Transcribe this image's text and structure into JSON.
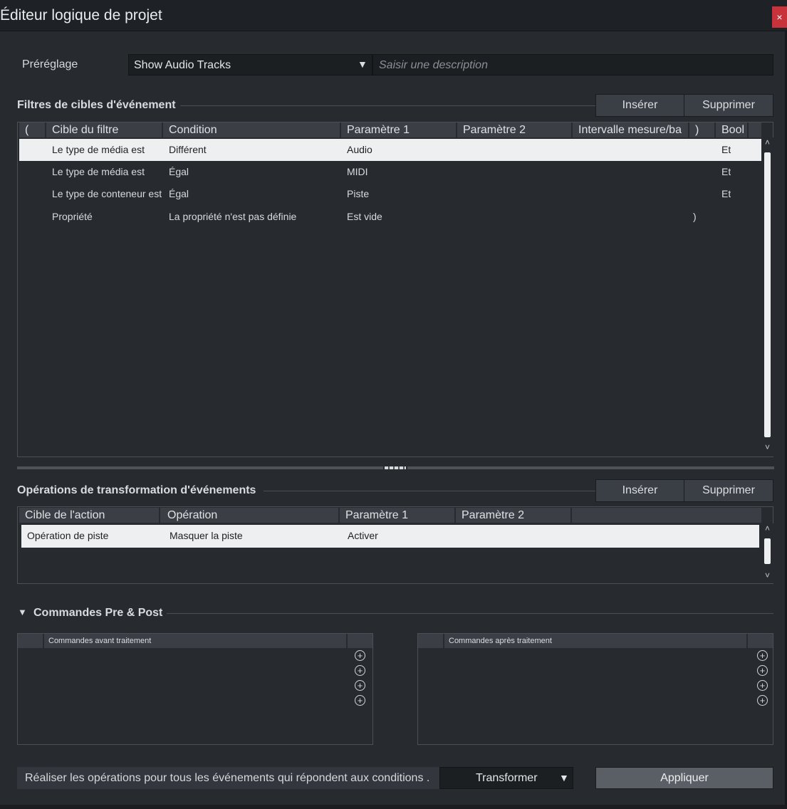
{
  "window": {
    "title": "Éditeur logique de projet",
    "close_icon": "×"
  },
  "preset": {
    "label": "Préréglage",
    "value": "Show Audio Tracks",
    "dropdown_icon": "▼",
    "description_placeholder": "Saisir une description"
  },
  "filters": {
    "title": "Filtres de cibles d'événement",
    "insert_label": "Insérer",
    "delete_label": "Supprimer",
    "headers": [
      "(",
      "Cible du filtre",
      "Condition",
      "Paramètre 1",
      "Paramètre 2",
      "Intervalle mesure/ba",
      ")",
      "Bool"
    ],
    "rows": [
      {
        "open": "",
        "target": "Le type de média est",
        "condition": "Différent",
        "param1": "Audio",
        "param2": "",
        "range": "",
        "close": "",
        "bool": "Et"
      },
      {
        "open": "",
        "target": "Le type de média est",
        "condition": "Égal",
        "param1": "MIDI",
        "param2": "",
        "range": "",
        "close": "",
        "bool": "Et"
      },
      {
        "open": "",
        "target": "Le type de conteneur est",
        "condition": "Égal",
        "param1": "Piste",
        "param2": "",
        "range": "",
        "close": "",
        "bool": "Et"
      },
      {
        "open": "",
        "target": "Propriété",
        "condition": "La propriété n'est pas définie",
        "param1": "Est vide",
        "param2": "",
        "range": "",
        "close": ")",
        "bool": ""
      }
    ],
    "scroll_up": "˄",
    "scroll_down": "˅"
  },
  "operations": {
    "title": "Opérations de transformation d'événements",
    "insert_label": "Insérer",
    "delete_label": "Supprimer",
    "headers": [
      "Cible de l'action",
      "Opération",
      "Paramètre 1",
      "Paramètre 2"
    ],
    "rows": [
      {
        "target": "Opération de piste",
        "operation": "Masquer la piste",
        "param1": "Activer",
        "param2": ""
      }
    ],
    "scroll_up": "˄",
    "scroll_down": "˅"
  },
  "commands": {
    "title": "Commandes Pre & Post",
    "toggle_icon": "▼",
    "pre_header": "Commandes avant traitement",
    "post_header": "Commandes après traitement",
    "add_icon": "+"
  },
  "footer": {
    "text": "Réaliser les opérations pour tous les événements qui répondent aux conditions .",
    "function_value": "Transformer",
    "dropdown_icon": "▼",
    "apply_label": "Appliquer"
  }
}
